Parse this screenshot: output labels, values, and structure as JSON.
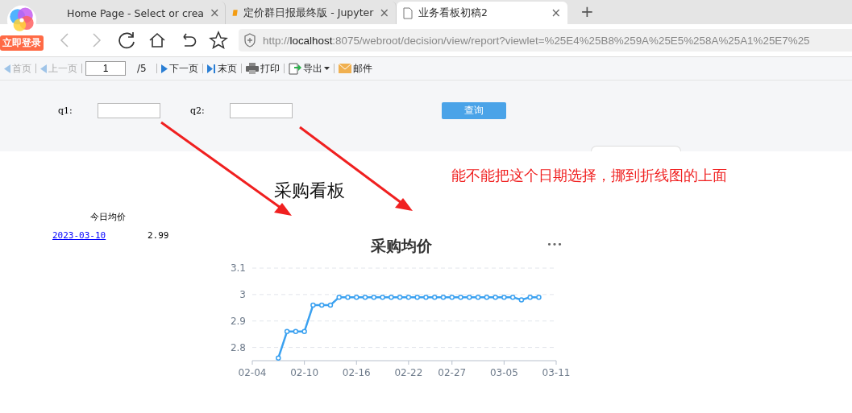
{
  "browser": {
    "login_badge": "立即登录",
    "tabs": [
      {
        "kind": "jupyter",
        "title": "Home Page - Select or crea",
        "close": "×",
        "selected": false
      },
      {
        "kind": "notebook",
        "title": "定价群日报最终版 - Jupyter",
        "close": "×",
        "selected": false
      },
      {
        "kind": "page",
        "title": "业务看板初稿2",
        "close": "×",
        "selected": true
      }
    ],
    "new_tab": "+",
    "url_scheme": "http://",
    "url_host": "localhost",
    "url_rest": ":8075/webroot/decision/view/report?viewlet=%25E4%25B8%259A%25E5%258A%25A1%25E7%25"
  },
  "toolbar": {
    "items": [
      {
        "kind": "first",
        "label": "首页",
        "disabled": true
      },
      {
        "kind": "prev",
        "label": "上一页",
        "disabled": true
      },
      {
        "kind": "page",
        "value": "1",
        "total": "/5"
      },
      {
        "kind": "next",
        "label": "下一页",
        "disabled": false
      },
      {
        "kind": "last",
        "label": "末页",
        "disabled": false
      },
      {
        "kind": "print",
        "label": "打印",
        "disabled": false
      },
      {
        "kind": "export",
        "label": "导出",
        "disabled": false
      },
      {
        "kind": "mail",
        "label": "邮件",
        "disabled": false
      }
    ]
  },
  "params": {
    "fields": [
      {
        "label": "q1:"
      },
      {
        "label": "q2:"
      }
    ],
    "query_button": "查询"
  },
  "report": {
    "title": "采购看板",
    "table": {
      "header": "今日均价",
      "rows": [
        {
          "date": "2023-03-10",
          "value": "2.99"
        }
      ]
    },
    "chart": {
      "menu": "•••",
      "chart_data": {
        "type": "line",
        "title": "采购均价",
        "categories": [
          "02-04",
          null,
          null,
          null,
          null,
          null,
          "02-10",
          null,
          null,
          null,
          null,
          null,
          "02-16",
          null,
          null,
          null,
          null,
          null,
          "02-22",
          null,
          null,
          null,
          null,
          "02-27",
          null,
          null,
          null,
          null,
          null,
          "03-05",
          null,
          null,
          null,
          null,
          null,
          "03-11"
        ],
        "series": [
          {
            "color": "#3ba1f0",
            "marker": "circle",
            "values": [
              null,
              null,
              null,
              2.76,
              2.86,
              2.86,
              2.86,
              2.96,
              2.96,
              2.96,
              2.99,
              2.99,
              2.99,
              2.99,
              2.99,
              2.99,
              2.99,
              2.99,
              2.99,
              2.99,
              2.99,
              2.99,
              2.99,
              2.99,
              2.99,
              2.99,
              2.99,
              2.99,
              2.99,
              2.99,
              2.99,
              2.98,
              2.99,
              2.99,
              null,
              null
            ]
          }
        ],
        "ylim": [
          2.75,
          3.1
        ],
        "grid": true,
        "yticks": [
          {
            "value": 2.8,
            "label": "2.8"
          },
          {
            "value": 2.9,
            "label": "2.9"
          },
          {
            "value": 3,
            "label": "3"
          },
          {
            "value": 3.1,
            "label": "3.1"
          }
        ]
      }
    }
  },
  "annotation": {
    "text": "能不能把这个日期选择，挪到折线图的上面"
  }
}
